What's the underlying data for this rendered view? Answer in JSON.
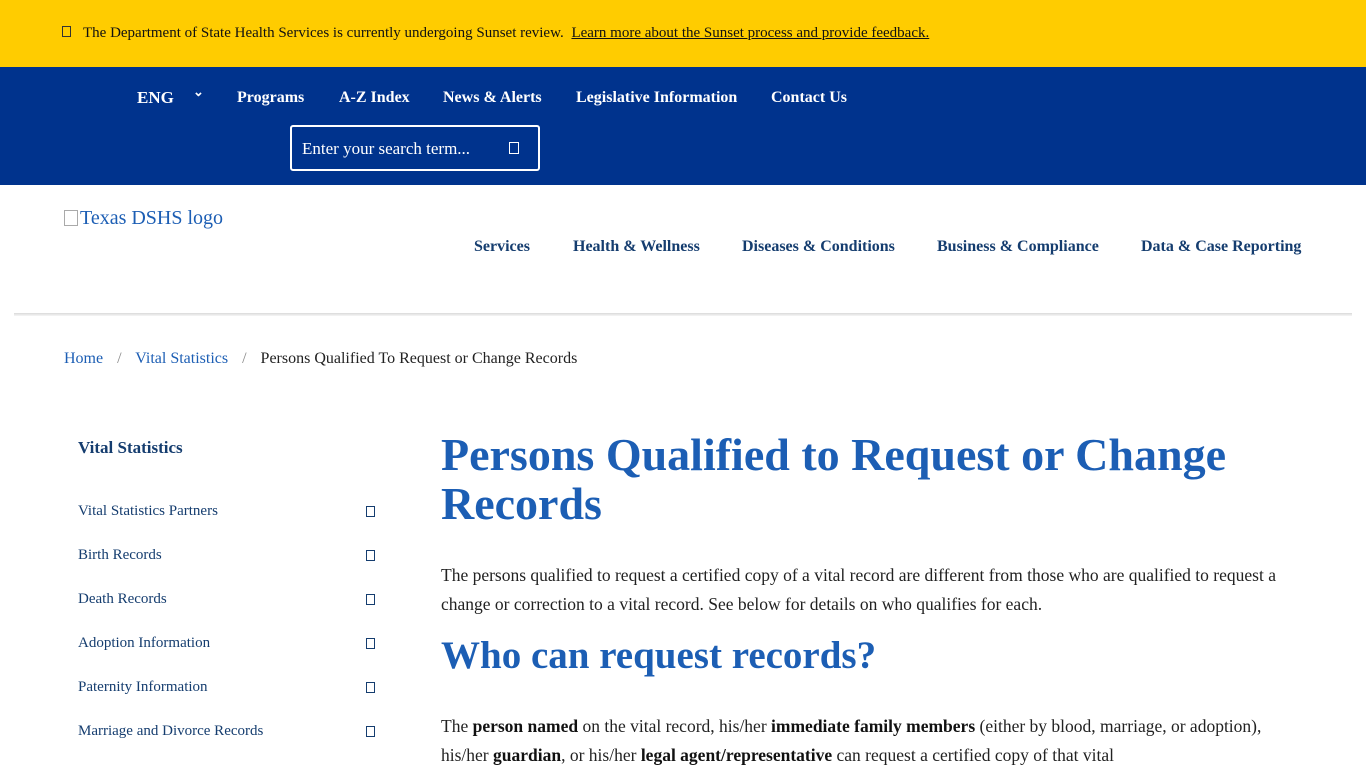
{
  "alert": {
    "text": "The Department of State Health Services is currently undergoing Sunset review.",
    "link": "Learn more about the Sunset process and provide feedback."
  },
  "topnav": {
    "language": "ENG",
    "items": [
      "Programs",
      "A-Z Index",
      "News & Alerts",
      "Legislative Information",
      "Contact Us"
    ],
    "search_placeholder": "Enter your search term..."
  },
  "header": {
    "logo_alt": "Texas DSHS logo",
    "nav": [
      "Services",
      "Health & Wellness",
      "Diseases & Conditions",
      "Business & Compliance",
      "Data & Case Reporting"
    ]
  },
  "breadcrumb": {
    "home": "Home",
    "section": "Vital Statistics",
    "current": "Persons Qualified To Request or Change Records",
    "separator": "/"
  },
  "sidebar": {
    "title": "Vital Statistics",
    "items": [
      "Vital Statistics Partners",
      "Birth Records",
      "Death Records",
      "Adoption Information",
      "Paternity Information",
      "Marriage and Divorce Records"
    ]
  },
  "main": {
    "title": "Persons Qualified to Request or Change Records",
    "intro": "The persons qualified to request a certified copy of a vital record are different from those who are qualified to request a change or correction to a vital record. See below for details on who qualifies for each.",
    "h2": "Who can request records?",
    "p2": {
      "t1": "The ",
      "b1": "person named",
      "t2": " on the vital record, his/her ",
      "b2": "immediate family members",
      "t3": " (either by blood, marriage, or adoption), his/her ",
      "b3": "guardian",
      "t4": ", or his/her ",
      "b4": "legal agent/representative",
      "t5": " can request a certified copy of that vital"
    }
  },
  "colors": {
    "alert_bg": "#ffcc00",
    "topnav_bg": "#00338d",
    "heading_blue": "#1c5eb4",
    "nav_text": "#153d6f"
  }
}
